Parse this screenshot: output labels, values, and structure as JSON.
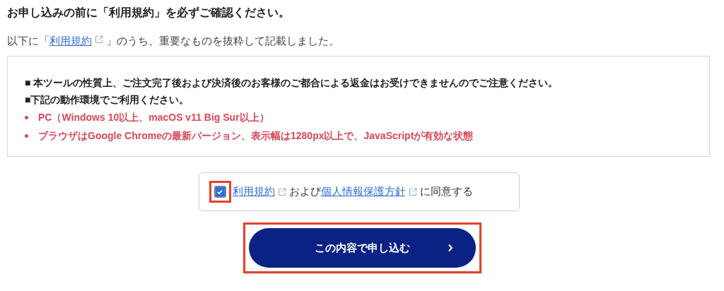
{
  "heading": "お申し込みの前に「利用規約」を必ずご確認ください。",
  "intro": [
    {
      "kind": "text",
      "text": "以下に「"
    },
    {
      "kind": "link",
      "text": "利用規約"
    },
    {
      "kind": "text",
      "text": "」のうち、重要なものを抜粋して記載しました。"
    }
  ],
  "notice": [
    {
      "kind": "note",
      "text": "■ 本ツールの性質上、ご注文完了後および決済後のお客様のご都合による返金はお受けできませんのでご注意ください。"
    },
    {
      "kind": "note",
      "text": "■下記の動作環境でご利用ください。"
    },
    {
      "kind": "bullet",
      "text": "PC（Windows 10以上、macOS v11 Big Sur以上）"
    },
    {
      "kind": "bullet",
      "text": "ブラウザはGoogle Chromeの最新バージョン、表示幅は1280px以上で、JavaScriptが有効な状態"
    }
  ],
  "agreement": {
    "checked": true,
    "highlighted": true,
    "parts": [
      {
        "kind": "link",
        "text": "利用規約"
      },
      {
        "kind": "text",
        "text": "および"
      },
      {
        "kind": "link",
        "text": "個人情報保護方針"
      },
      {
        "kind": "text",
        "text": "に同意する"
      }
    ]
  },
  "submit": {
    "label": "この内容で申し込む",
    "highlighted": true
  }
}
